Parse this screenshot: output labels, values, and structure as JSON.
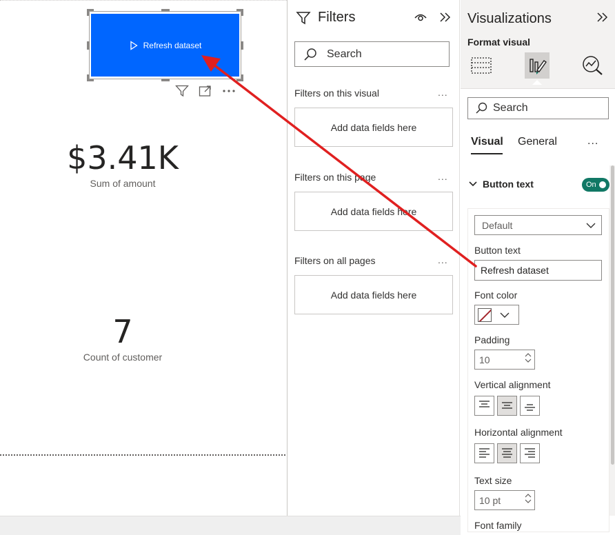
{
  "canvas": {
    "button_label": "Refresh dataset",
    "kpis": [
      {
        "value": "$3.41K",
        "label": "Sum of amount"
      },
      {
        "value": "7",
        "label": "Count of customer"
      }
    ]
  },
  "filters": {
    "title": "Filters",
    "search_placeholder": "Search",
    "sections": [
      {
        "title": "Filters on this visual",
        "more": "...",
        "drop_hint": "Add data fields here"
      },
      {
        "title": "Filters on this page",
        "more": "...",
        "drop_hint": "Add data fields here"
      },
      {
        "title": "Filters on all pages",
        "more": "...",
        "drop_hint": "Add data fields here"
      }
    ]
  },
  "viz": {
    "title": "Visualizations",
    "format_label": "Format visual",
    "search_placeholder": "Search",
    "tabs": [
      "Visual",
      "General"
    ],
    "tab_more": "...",
    "section": "Button text",
    "toggle_label": "On",
    "state_select": "Default",
    "fields": {
      "button_text_label": "Button text",
      "button_text_value": "Refresh dataset",
      "font_color_label": "Font color",
      "padding_label": "Padding",
      "padding_value": "10",
      "vertical_label": "Vertical alignment",
      "horizontal_label": "Horizontal alignment",
      "text_size_label": "Text size",
      "text_size_value": "10 pt",
      "font_family_label": "Font family"
    }
  },
  "colors": {
    "button_fill": "#0066ff",
    "toggle_on": "#117865",
    "annotation_arrow": "#e02020"
  }
}
